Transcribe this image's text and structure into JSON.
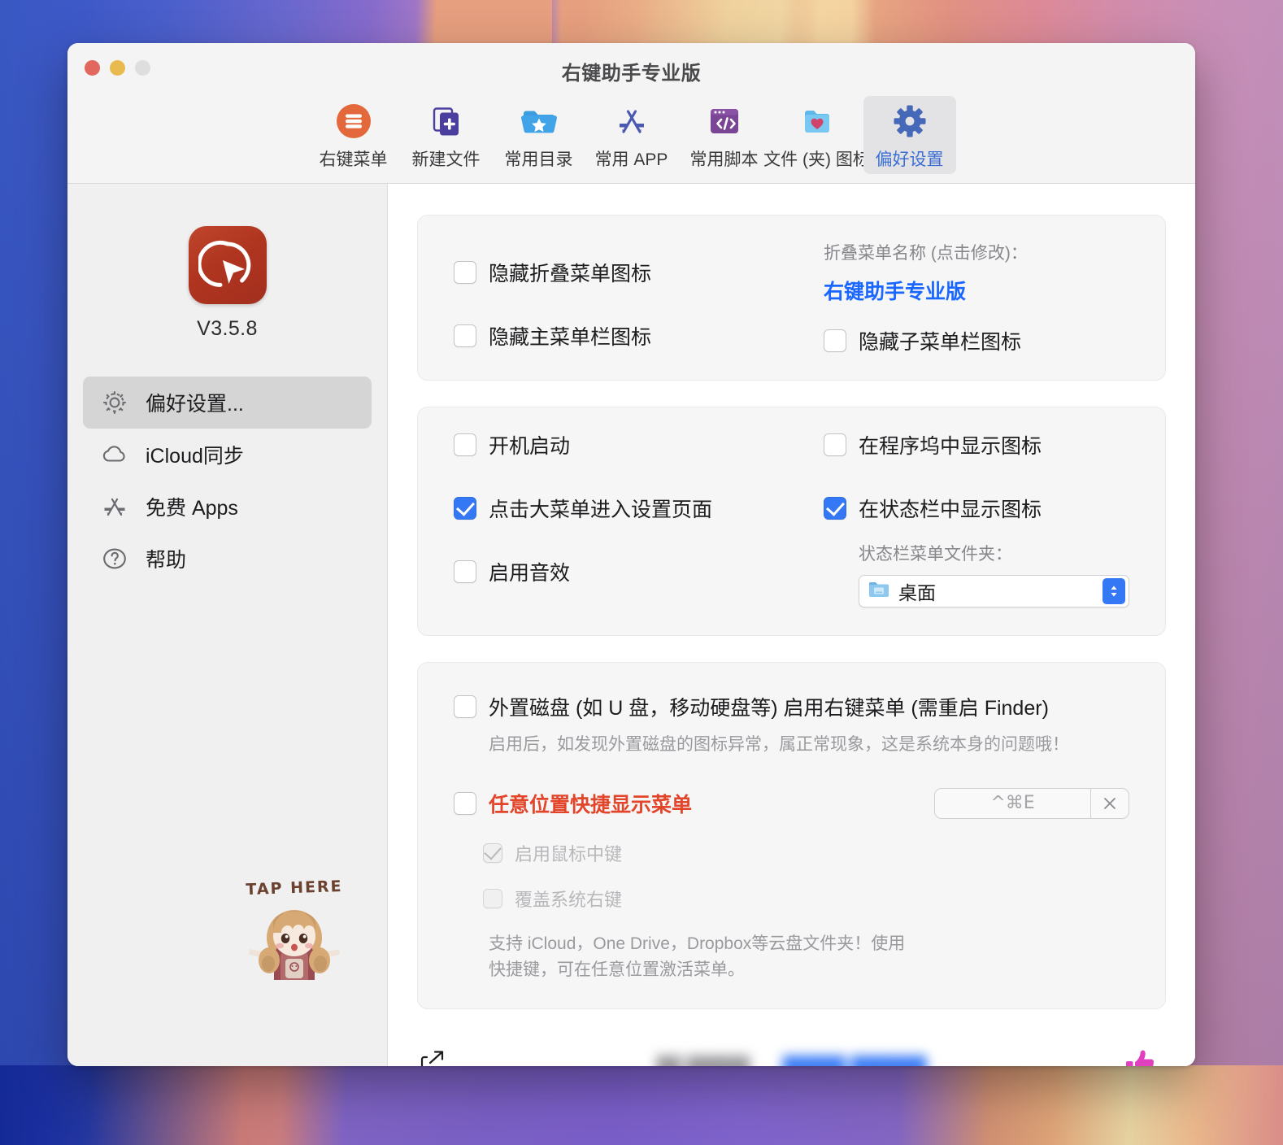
{
  "window": {
    "title": "右键助手专业版",
    "traffic_lights": [
      "close-button",
      "minimize-button",
      "zoom-button"
    ]
  },
  "toolbar": {
    "items": [
      {
        "icon": "hamburger-menu-icon",
        "label": "右键菜单",
        "active": false
      },
      {
        "icon": "new-file-icon",
        "label": "新建文件",
        "active": false
      },
      {
        "icon": "folder-star-icon",
        "label": "常用目录",
        "active": false
      },
      {
        "icon": "app-store-icon",
        "label": "常用 APP",
        "active": false
      },
      {
        "icon": "code-window-icon",
        "label": "常用脚本",
        "active": false
      },
      {
        "icon": "folder-heart-icon",
        "label": "文件 (夹) 图标",
        "active": false
      },
      {
        "icon": "gear-icon",
        "label": "偏好设置",
        "active": true
      }
    ]
  },
  "sidebar": {
    "app_icon": "cursor-app-icon",
    "version": "V3.5.8",
    "items": [
      {
        "icon": "gear-icon",
        "label": "偏好设置...",
        "selected": true
      },
      {
        "icon": "cloud-icon",
        "label": "iCloud同步",
        "selected": false
      },
      {
        "icon": "app-store-icon",
        "label": "免费 Apps",
        "selected": false
      },
      {
        "icon": "question-circle-icon",
        "label": "帮助",
        "selected": false
      }
    ],
    "sticker": {
      "text": "TAP HERE",
      "art": "cartoon-girl-mascot"
    }
  },
  "panels": {
    "menu_icons": {
      "hide_folded_menu_icon": {
        "label": "隐藏折叠菜单图标",
        "checked": false
      },
      "hide_main_menubar_icon": {
        "label": "隐藏主菜单栏图标",
        "checked": false
      },
      "folded_menu_name_caption": "折叠菜单名称 (点击修改)：",
      "folded_menu_name_value": "右键助手专业版",
      "hide_sub_menubar_icon": {
        "label": "隐藏子菜单栏图标",
        "checked": false
      }
    },
    "general": {
      "launch_at_login": {
        "label": "开机启动",
        "checked": false
      },
      "click_big_menu_opens_settings": {
        "label": "点击大菜单进入设置页面",
        "checked": true
      },
      "enable_sound": {
        "label": "启用音效",
        "checked": false
      },
      "show_in_dock": {
        "label": "在程序坞中显示图标",
        "checked": false
      },
      "show_in_statusbar": {
        "label": "在状态栏中显示图标",
        "checked": true
      },
      "statusbar_folder_caption": "状态栏菜单文件夹：",
      "statusbar_folder_value": "桌面",
      "statusbar_folder_icon": "folder-icon"
    },
    "advanced": {
      "external_disk": {
        "label": "外置磁盘 (如 U 盘，移动硬盘等) 启用右键菜单 (需重启 Finder)",
        "checked": false,
        "hint": "启用后，如发现外置磁盘的图标异常，属正常现象，这是系统本身的问题哦！"
      },
      "anywhere_shortcut": {
        "label": "任意位置快捷显示菜单",
        "checked": false,
        "shortcut": "^⌘E",
        "clear_icon": "close-icon"
      },
      "enable_middle_click": {
        "label": "启用鼠标中键",
        "checked": true,
        "disabled": true
      },
      "override_system_right_click": {
        "label": "覆盖系统右键",
        "checked": false,
        "disabled": true
      },
      "cloud_hint_line1": "支持 iCloud，One Drive，Dropbox等云盘文件夹！使用",
      "cloud_hint_line2": "快捷键，可在任意位置激活菜单。"
    }
  },
  "footer": {
    "share_icon": "share-export-icon",
    "thumbs_up_icon": "thumbs-up-icon",
    "redacted_grey": "██ █████",
    "redacted_blue": "█████ ██████"
  },
  "colors": {
    "accent_blue": "#3478f6",
    "link_blue": "#1a67ff",
    "warning_red": "#e3452a",
    "tab_active_text": "#3c6fd4",
    "thumbs_up": "#e040c0",
    "app_icon_red": "#b03520"
  }
}
